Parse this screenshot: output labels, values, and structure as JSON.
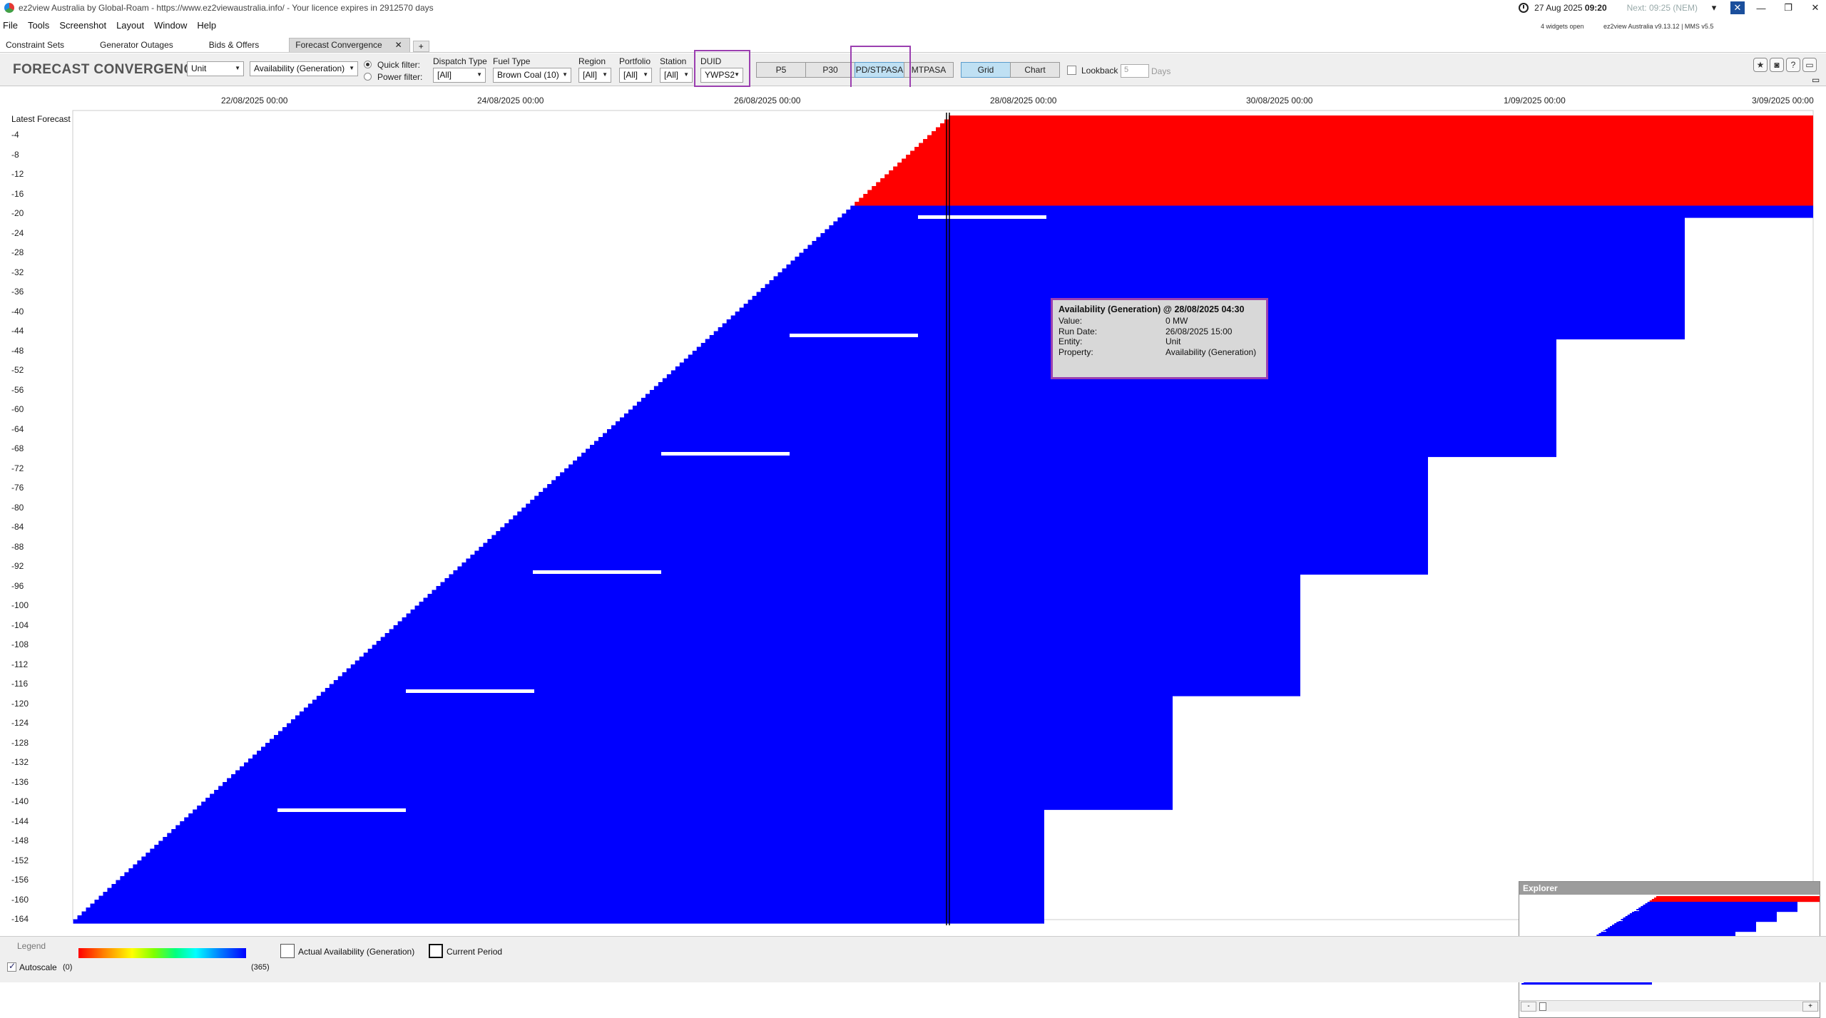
{
  "window": {
    "title": "ez2view Australia by Global-Roam - https://www.ez2viewaustralia.info/ - Your licence expires in 2912570 days",
    "date": "27 Aug 2025",
    "time": "09:20",
    "next": "Next: 09:25 (NEM)",
    "widgets_open": "4 widgets open",
    "version": "ez2view Australia v9.13.12 | MMS v5.5"
  },
  "menu": [
    "File",
    "Tools",
    "Screenshot",
    "Layout",
    "Window",
    "Help"
  ],
  "tabs": [
    "Constraint Sets",
    "Generator Outages",
    "Bids & Offers",
    "Forecast Convergence"
  ],
  "active_tab": "Forecast Convergence",
  "toolbar": {
    "title": "FORECAST CONVERGENCE",
    "mode_select": "Unit",
    "property_select": "Availability (Generation)",
    "quick_filter_label": "Quick filter:",
    "power_filter_label": "Power filter:",
    "filters": [
      {
        "label": "Dispatch Type",
        "value": "[All]"
      },
      {
        "label": "Fuel Type",
        "value": "Brown Coal (10)"
      },
      {
        "label": "Region",
        "value": "[All]"
      },
      {
        "label": "Portfolio",
        "value": "[All]"
      },
      {
        "label": "Station",
        "value": "[All]"
      },
      {
        "label": "DUID",
        "value": "YWPS2"
      }
    ],
    "horizons": [
      "P5",
      "P30",
      "PD/STPASA",
      "MTPASA"
    ],
    "selected_horizon": "PD/STPASA",
    "views": [
      "Grid",
      "Chart"
    ],
    "selected_view": "Grid",
    "lookback_label": "Lookback",
    "lookback_value": "5",
    "lookback_unit": "Days"
  },
  "grid": {
    "x_ticks": [
      "22/08/2025 00:00",
      "24/08/2025 00:00",
      "26/08/2025 00:00",
      "28/08/2025 00:00",
      "30/08/2025 00:00",
      "1/09/2025 00:00",
      "3/09/2025 00:00"
    ],
    "y_header": "Latest Forecast",
    "y_ticks": [
      "-4",
      "-8",
      "-12",
      "-16",
      "-20",
      "-24",
      "-28",
      "-32",
      "-36",
      "-40",
      "-44",
      "-48",
      "-52",
      "-56",
      "-60",
      "-64",
      "-68",
      "-72",
      "-76",
      "-80",
      "-84",
      "-88",
      "-92",
      "-96",
      "-100",
      "-104",
      "-108",
      "-112",
      "-116",
      "-120",
      "-124",
      "-128",
      "-132",
      "-136",
      "-140",
      "-144",
      "-148",
      "-152",
      "-156",
      "-160",
      "-164"
    ],
    "colors": {
      "low": "#ff0000",
      "high": "#0000ff"
    }
  },
  "tooltip": {
    "title": "Availability (Generation) @ 28/08/2025 04:30",
    "rows": [
      {
        "k": "Value:",
        "v": "0 MW"
      },
      {
        "k": "Run Date:",
        "v": "26/08/2025 15:00"
      },
      {
        "k": "Entity:",
        "v": "Unit"
      },
      {
        "k": "Property:",
        "v": "Availability (Generation)"
      }
    ]
  },
  "explorer": {
    "title": "Explorer"
  },
  "legend": {
    "title": "Legend",
    "min": "(0)",
    "max": "(365)",
    "actual_label": "Actual Availability (Generation)",
    "current_label": "Current Period",
    "autoscale_label": "Autoscale"
  }
}
